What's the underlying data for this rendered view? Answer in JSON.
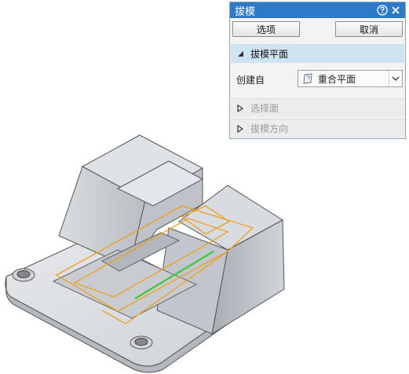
{
  "dialog": {
    "title": "拔模",
    "help_icon": "help-icon",
    "close_icon": "close-icon",
    "options_label": "选项",
    "cancel_label": "取消",
    "groups": [
      {
        "label": "拔模平面",
        "expanded": true
      },
      {
        "label": "选择面",
        "expanded": false
      },
      {
        "label": "拔模方向",
        "expanded": false
      }
    ],
    "create_from_label": "创建自",
    "create_from_value": "重合平面",
    "create_from_icon": "plane-icon",
    "accent_color": "#2f7ac6",
    "header_color": "#cfe4f3"
  },
  "viewport": {
    "part_color": "#c8ccd2",
    "sketch_color": "#f0a020",
    "edge_highlight_color": "#3cc83c"
  }
}
